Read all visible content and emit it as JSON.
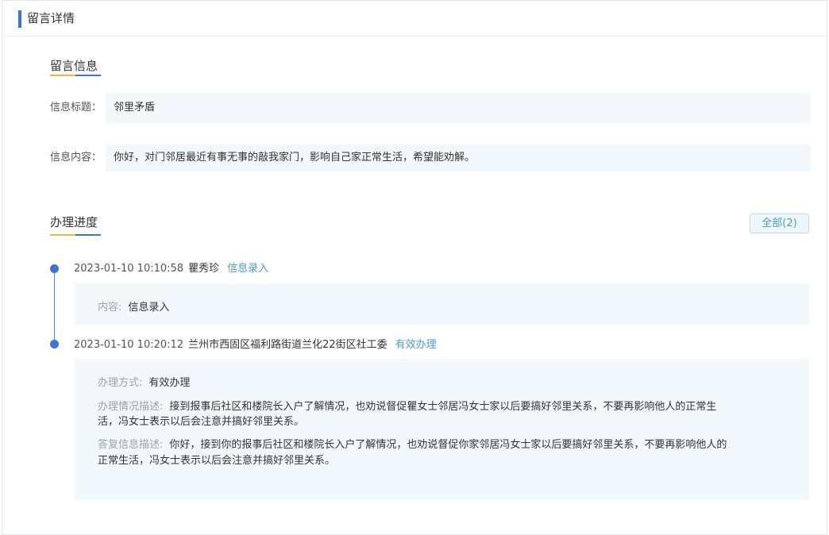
{
  "header": {
    "title": "留言详情"
  },
  "message_section": {
    "title": "留言信息",
    "subject_label": "信息标题：",
    "subject_value": "邻里矛盾",
    "content_label": "信息内容：",
    "content_value": "你好，对门邻居最近有事无事的敲我家门，影响自己家正常生活，希望能劝解。"
  },
  "progress_section": {
    "title": "办理进度",
    "all_button": "全部(2)",
    "entries": [
      {
        "time": "2023-01-10 10:10:58",
        "handler": "瞿秀珍",
        "status": "信息录入",
        "content_label": "内容:",
        "content_value": "信息录入"
      },
      {
        "time": "2023-01-10 10:20:12",
        "handler": "兰州市西固区福利路街道兰化22街区社工委",
        "status": "有效办理",
        "method_label": "办理方式:",
        "method_value": "有效办理",
        "situation_label": "办理情况描述:",
        "situation_value_line1": "接到报事后社区和楼院长入户了解情况，也劝说督促瞿女士邻居冯女士家以后要搞好邻里关系，不要再影响他人的正常生",
        "situation_value_line2": "活，冯女士表示以后会注意并搞好邻里关系。",
        "reply_label": "答复信息描述:",
        "reply_value_line1": "你好，接到你的报事后社区和楼院长入户了解情况，也劝说督促你家邻居冯女士家以后要搞好邻里关系，不要再影响他人的",
        "reply_value_line2": "正常生活，冯女士表示以后会注意并搞好邻里关系。"
      }
    ]
  },
  "colors": {
    "accent_blue": "#3d74d6",
    "accent_yellow": "#f0b63a",
    "status_link": "#4a9ac9",
    "field_bg": "#f3f8fd"
  }
}
